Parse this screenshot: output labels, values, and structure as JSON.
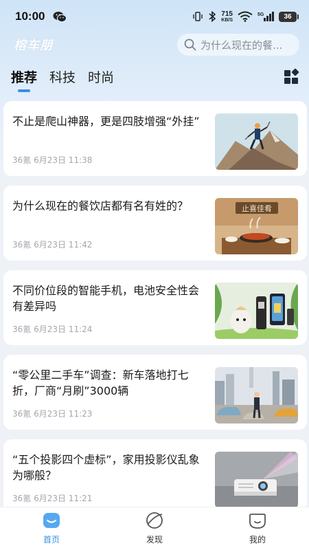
{
  "status_bar": {
    "time": "10:00",
    "net_speed": "715",
    "net_unit": "KB/S",
    "network_type": "5G",
    "battery": "36"
  },
  "header": {
    "logo": "榕车朋",
    "search_placeholder": "为什么现在的餐..."
  },
  "tabs": [
    {
      "label": "推荐",
      "active": true
    },
    {
      "label": "科技",
      "active": false
    },
    {
      "label": "时尚",
      "active": false
    }
  ],
  "articles": [
    {
      "title": "不止是爬山神器，更是四肢增强“外挂”",
      "meta": "36氪 6月23日 11:38",
      "image": "hiker-illustration"
    },
    {
      "title": "为什么现在的餐饮店都有名有姓的？",
      "meta": "36氪 6月23日 11:42",
      "image": "restaurant-illustration",
      "sign_text": "止喜佳肴"
    },
    {
      "title": "不同价位段的智能手机，电池安全性会有差异吗",
      "meta": "36氪 6月23日 11:24",
      "image": "phone-battery-illustration"
    },
    {
      "title": "“零公里二手车”调查：新车落地打七折，厂商“月刷”3000辆",
      "meta": "36氪 6月23日 11:23",
      "image": "car-lot-illustration"
    },
    {
      "title": "“五个投影四个虚标”，家用投影仪乱象为哪般？",
      "meta": "36氪 6月23日 11:21",
      "image": "projector-illustration"
    }
  ],
  "bottom_nav": [
    {
      "label": "首页",
      "icon": "home-icon",
      "active": true
    },
    {
      "label": "发现",
      "icon": "discover-icon",
      "active": false
    },
    {
      "label": "我的",
      "icon": "profile-icon",
      "active": false
    }
  ],
  "colors": {
    "accent": "#3a8ee6",
    "meta_text": "#a3a7ad"
  }
}
